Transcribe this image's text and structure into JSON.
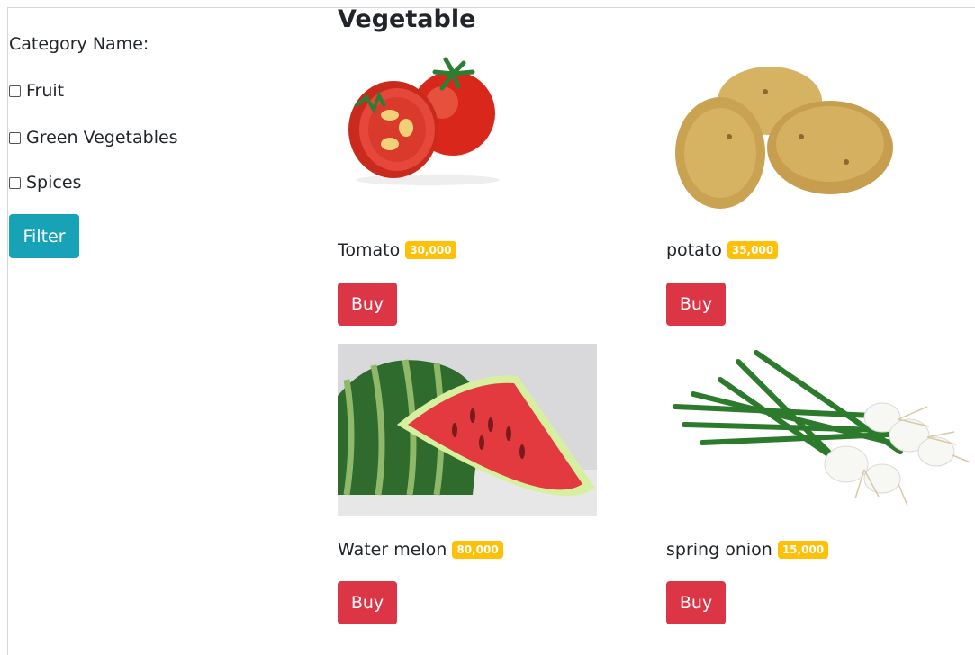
{
  "sidebar": {
    "title": "Category Name:",
    "categories": [
      {
        "label": "Fruit",
        "checked": false
      },
      {
        "label": "Green Vegetables",
        "checked": false
      },
      {
        "label": "Spices",
        "checked": false
      }
    ],
    "filter_label": "Filter"
  },
  "main": {
    "heading": "Vegetable",
    "products": [
      {
        "name": "Tomato",
        "price": "30,000",
        "buy_label": "Buy",
        "image": "tomato-image"
      },
      {
        "name": "potato",
        "price": "35,000",
        "buy_label": "Buy",
        "image": "potato-image"
      },
      {
        "name": "Water melon",
        "price": "80,000",
        "buy_label": "Buy",
        "image": "watermelon-image"
      },
      {
        "name": "spring onion",
        "price": "15,000",
        "buy_label": "Buy",
        "image": "spring-onion-image"
      }
    ]
  },
  "colors": {
    "filter": "#17a2b8",
    "buy": "#dc3545",
    "badge": "#ffc107"
  }
}
